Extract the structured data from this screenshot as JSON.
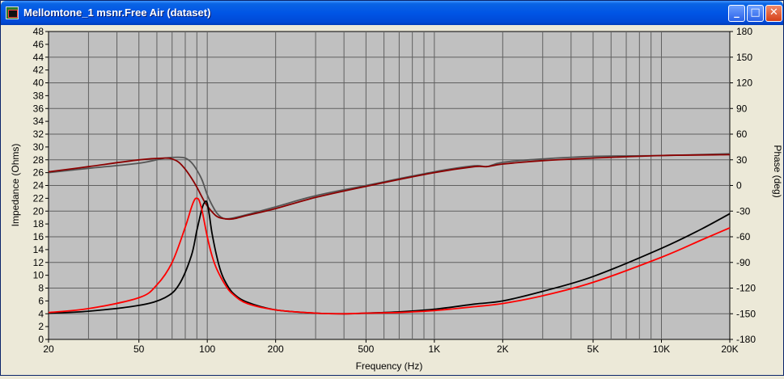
{
  "window": {
    "title": "Mellomtone_1 msnr.Free Air (dataset)",
    "buttons": {
      "minimize": "_",
      "maximize": "□",
      "close": "✕"
    }
  },
  "chart_data": {
    "type": "line",
    "xlabel": "Frequency (Hz)",
    "ylabel": "Impedance (Ohms)",
    "y2label": "Phase (deg)",
    "xscale": "log",
    "xlim": [
      20,
      20000
    ],
    "ylim": [
      0,
      48
    ],
    "y2lim": [
      -180,
      180
    ],
    "grid": true,
    "xticks": [
      20,
      50,
      100,
      200,
      500,
      1000,
      2000,
      5000,
      10000,
      20000
    ],
    "xtick_labels": [
      "20",
      "50",
      "100",
      "200",
      "500",
      "1K",
      "2K",
      "5K",
      "10K",
      "20K"
    ],
    "yticks": [
      0,
      2,
      4,
      6,
      8,
      10,
      12,
      14,
      16,
      18,
      20,
      22,
      24,
      26,
      28,
      30,
      32,
      34,
      36,
      38,
      40,
      42,
      44,
      46,
      48
    ],
    "y2ticks": [
      -180,
      -150,
      -120,
      -90,
      -60,
      -30,
      0,
      30,
      60,
      90,
      120,
      150,
      180
    ],
    "series": [
      {
        "axis": "phase",
        "color": "#555555",
        "x": [
          20,
          30,
          50,
          65,
          75,
          80,
          85,
          90,
          95,
          100,
          105,
          110,
          115,
          120,
          130,
          150,
          200,
          300,
          500,
          1000,
          1500,
          1700,
          2000,
          3000,
          5000,
          10000,
          20000
        ],
        "y": [
          15,
          20,
          26,
          32,
          33,
          32,
          27,
          18,
          6,
          -11,
          -23,
          -32,
          -37,
          -39,
          -38,
          -34,
          -25,
          -12,
          0,
          16,
          23,
          22,
          27,
          31,
          34,
          35,
          37
        ]
      },
      {
        "axis": "phase",
        "color": "#8b0000",
        "x": [
          20,
          30,
          50,
          65,
          70,
          75,
          80,
          85,
          90,
          95,
          100,
          110,
          120,
          130,
          150,
          200,
          300,
          500,
          1000,
          1500,
          1700,
          2000,
          3000,
          5000,
          10000,
          20000
        ],
        "y": [
          16,
          22,
          30,
          32,
          31,
          27,
          19,
          9,
          -2,
          -14,
          -24,
          -36,
          -39,
          -39,
          -35,
          -27,
          -14,
          -1,
          15,
          22,
          22,
          25,
          29,
          32,
          35,
          36
        ]
      },
      {
        "axis": "impedance",
        "color": "#000000",
        "x": [
          20,
          30,
          50,
          65,
          75,
          85,
          90,
          95,
          98,
          100,
          102,
          105,
          110,
          115,
          120,
          130,
          150,
          200,
          300,
          400,
          500,
          700,
          1000,
          1500,
          2000,
          3000,
          5000,
          10000,
          15000,
          20000
        ],
        "y": [
          4.1,
          4.4,
          5.3,
          6.5,
          8.5,
          13,
          17,
          20.5,
          21.5,
          21.2,
          19.5,
          16.5,
          13,
          10.5,
          9,
          7.2,
          5.8,
          4.6,
          4.1,
          4.0,
          4.1,
          4.3,
          4.7,
          5.5,
          6,
          7.5,
          9.8,
          14.2,
          17.2,
          19.6
        ]
      },
      {
        "axis": "impedance",
        "color": "#ff0000",
        "x": [
          20,
          30,
          50,
          60,
          70,
          80,
          85,
          88,
          90,
          92,
          95,
          100,
          105,
          110,
          120,
          130,
          150,
          200,
          300,
          400,
          500,
          700,
          1000,
          1500,
          2000,
          3000,
          5000,
          10000,
          15000,
          20000
        ],
        "y": [
          4.2,
          4.8,
          6.5,
          8.5,
          12,
          17.5,
          20.5,
          21.8,
          22,
          21.7,
          20,
          16,
          13,
          11,
          8.5,
          7,
          5.6,
          4.6,
          4.1,
          4.0,
          4.1,
          4.2,
          4.5,
          5.1,
          5.6,
          6.8,
          8.9,
          12.8,
          15.5,
          17.4
        ]
      }
    ]
  }
}
